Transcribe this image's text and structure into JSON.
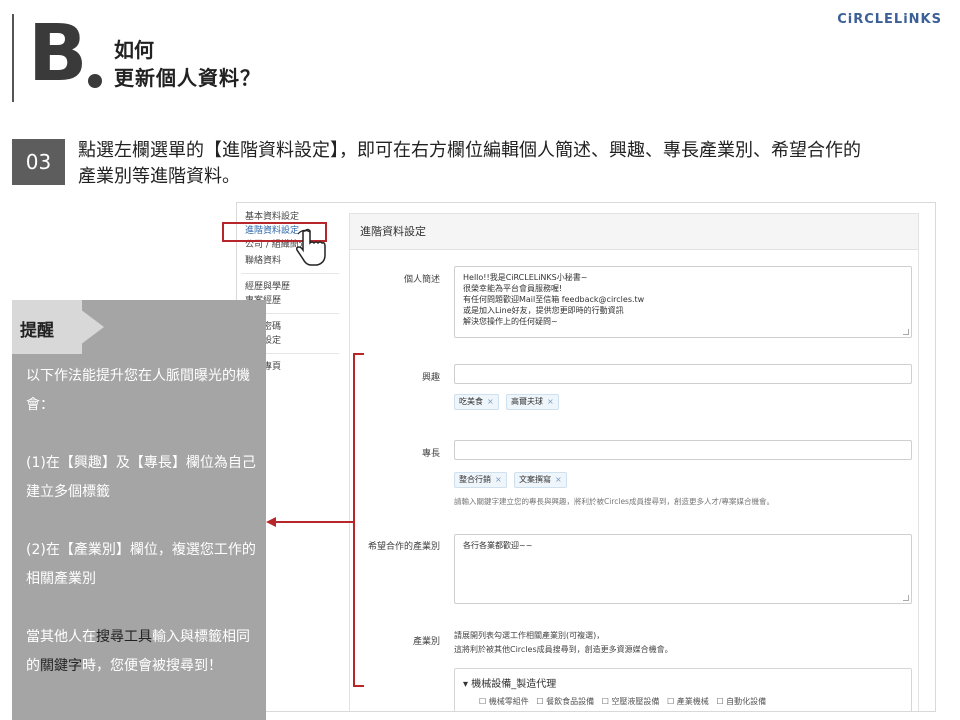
{
  "header": {
    "section_letter": "B",
    "title_line1": "如何",
    "title_line2": "更新個人資料？",
    "logo_main": "CiRCLELiNKS"
  },
  "step": {
    "number": "03",
    "text": "點選左欄選單的【進階資料設定】，即可在右方欄位編輯個人簡述、興趣、專長產業別、希望合作的產業別等進階資料。"
  },
  "screenshot": {
    "nav": {
      "items": [
        "基本資料設定",
        "進階資料設定",
        "公司 / 組織簡介",
        "聯絡資料",
        "經歷與學歷",
        "專案經歷",
        "修改密碼",
        "隱私設定",
        "設定專頁"
      ]
    },
    "panel_title": "進階資料設定",
    "bio": {
      "label": "個人簡述",
      "value": "Hello!!我是CiRCLELiNKS小秘書~\n很榮幸能為平台會員服務喔!\n有任何問題歡迎Mail至信箱 feedback@circles.tw\n或是加入Line好友，提供您更即時的行動資訊\n解決您操作上的任何疑問~"
    },
    "interest": {
      "label": "興趣",
      "tags": [
        "吃美食",
        "高爾夫球"
      ]
    },
    "skill": {
      "label": "專長",
      "tags": [
        "整合行銷",
        "文案撰寫"
      ],
      "hint": "請輸入關鍵字建立您的專長與興趣，將利於被Circles成員搜尋到，創造更多人才/專案媒合機會。"
    },
    "coop": {
      "label": "希望合作的產業別",
      "value": "各行各業都歡迎~~"
    },
    "industry": {
      "label": "產業別",
      "hint1": "請展開列表勾選工作相關產業別(可複選)，",
      "hint2": "這將利於被其他Circles成員搜尋到，創造更多資源媒合機會。",
      "group_title": "機械設備_製造代理",
      "options": [
        "機械零組件",
        "餐飲食品設備",
        "空壓液壓設備",
        "產業機械",
        "自動化設備"
      ]
    }
  },
  "tip": {
    "title": "提醒",
    "p1": "以下作法能提升您在人脈間曝光的機會：",
    "p2": "(1)在【興趣】及【專長】欄位為自己建立多個標籤",
    "p3": "(2)在【產業別】欄位，複選您工作的相關產業別",
    "p4_a": "當其他人在",
    "p4_em1": "搜尋工具",
    "p4_b": "輸入與標籤相同的",
    "p4_em2": "關鍵字",
    "p4_c": "時，您便會被搜尋到！"
  },
  "colors": {
    "highlight_red": "#b7262b",
    "link_blue": "#2c64a8",
    "tip_gray": "#a5a5a5",
    "badge_gray": "#5d5d5d"
  }
}
